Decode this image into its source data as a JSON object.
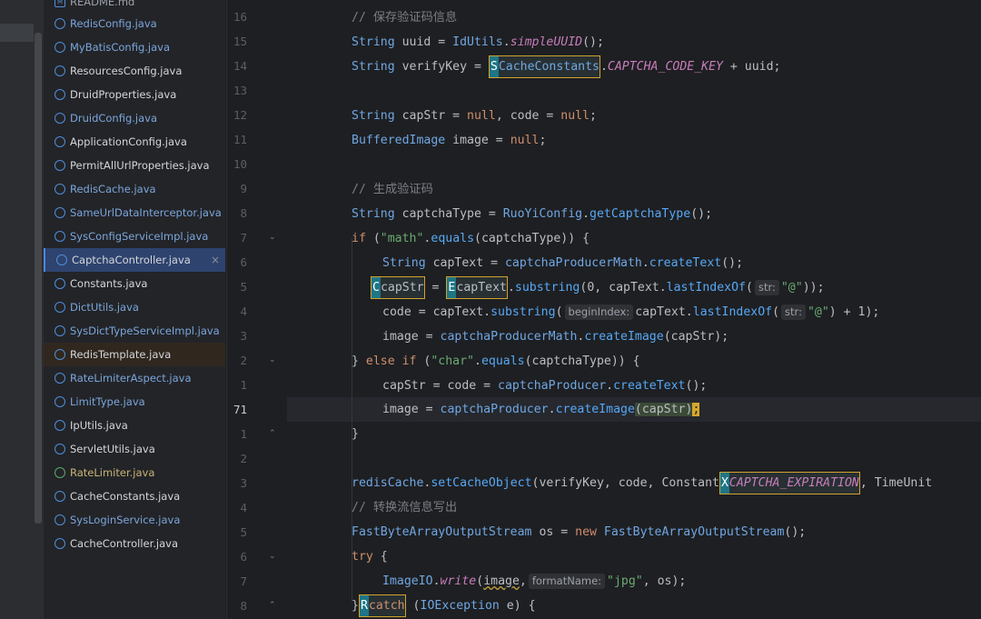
{
  "tree": {
    "top_partial": "README.md",
    "files": [
      {
        "name": "RedisConfig.java",
        "color": "blue"
      },
      {
        "name": "MyBatisConfig.java",
        "color": "blue"
      },
      {
        "name": "ResourcesConfig.java",
        "color": "normal"
      },
      {
        "name": "DruidProperties.java",
        "color": "normal"
      },
      {
        "name": "DruidConfig.java",
        "color": "blue"
      },
      {
        "name": "ApplicationConfig.java",
        "color": "normal"
      },
      {
        "name": "PermitAllUrlProperties.java",
        "color": "normal"
      },
      {
        "name": "RedisCache.java",
        "color": "blue"
      },
      {
        "name": "SameUrlDataInterceptor.java",
        "color": "blue"
      },
      {
        "name": "SysConfigServiceImpl.java",
        "color": "blue"
      },
      {
        "name": "CaptchaController.java",
        "color": "normal",
        "active": true
      },
      {
        "name": "Constants.java",
        "color": "normal"
      },
      {
        "name": "DictUtils.java",
        "color": "blue"
      },
      {
        "name": "SysDictTypeServiceImpl.java",
        "color": "blue"
      },
      {
        "name": "RedisTemplate.java",
        "color": "normal",
        "highlight": true
      },
      {
        "name": "RateLimiterAspect.java",
        "color": "blue"
      },
      {
        "name": "LimitType.java",
        "color": "blue"
      },
      {
        "name": "IpUtils.java",
        "color": "normal"
      },
      {
        "name": "ServletUtils.java",
        "color": "normal"
      },
      {
        "name": "RateLimiter.java",
        "color": "olive",
        "icon": "green"
      },
      {
        "name": "CacheConstants.java",
        "color": "normal"
      },
      {
        "name": "SysLoginService.java",
        "color": "blue"
      },
      {
        "name": "CacheController.java",
        "color": "normal"
      }
    ],
    "close_glyph": "×"
  },
  "gutter": {
    "line_numbers": [
      "16",
      "15",
      "14",
      "13",
      "12",
      "11",
      "10",
      "9",
      "8",
      "7",
      "6",
      "5",
      "4",
      "3",
      "2",
      "1",
      "71",
      "1",
      "2",
      "3",
      "4",
      "5",
      "6",
      "7",
      "8"
    ],
    "current_line": "71"
  },
  "hints": {
    "str": "str:",
    "beginIndex": "beginIndex:",
    "formatName": "formatName:"
  },
  "jump_labels": [
    "S",
    "C",
    "E",
    "X",
    "R"
  ],
  "code": {
    "l0": [
      "// 保存验证码信息"
    ],
    "l1": [
      "String",
      " uuid = ",
      "IdUtils",
      ".",
      "simpleUUID",
      "();"
    ],
    "l2": [
      "String",
      " verifyKey = ",
      "S",
      "CacheConstants",
      ".",
      "CAPTCHA_CODE_KEY",
      " + uuid;"
    ],
    "l4": [
      "String",
      " capStr = ",
      "null",
      ", code = ",
      "null",
      ";"
    ],
    "l5": [
      "BufferedImage",
      " image = ",
      "null",
      ";"
    ],
    "l7": [
      "// 生成验证码"
    ],
    "l8": [
      "String",
      " captchaType = ",
      "RuoYiConfig",
      ".",
      "getCaptchaType",
      "();"
    ],
    "l9": [
      "if",
      " (",
      "\"math\"",
      ".",
      "equals",
      "(captchaType)) {"
    ],
    "l10": [
      "String",
      " capText = ",
      "captchaProducerMath",
      ".",
      "createText",
      "();"
    ],
    "l11": [
      "C",
      "capStr",
      " = ",
      "E",
      "capText",
      ".",
      "substring",
      "(0, capText.",
      "lastIndexOf",
      "(",
      "\"@\"",
      "));"
    ],
    "l12": [
      "code = capText.",
      "substring",
      "(",
      "capText.",
      "lastIndexOf",
      "(",
      "\"@\"",
      ") + 1);"
    ],
    "l13": [
      "image = ",
      "captchaProducerMath",
      ".",
      "createImage",
      "(capStr);"
    ],
    "l14": [
      "} ",
      "else if",
      " (",
      "\"char\"",
      ".",
      "equals",
      "(captchaType)) {"
    ],
    "l15": [
      "capStr = code = ",
      "captchaProducer",
      ".",
      "createText",
      "();"
    ],
    "l16": [
      "image = ",
      "captchaProducer",
      ".",
      "createImage",
      "(capStr)",
      ";"
    ],
    "l17": [
      "}"
    ],
    "l19": [
      "redisCache",
      ".",
      "setCacheObject",
      "(verifyKey, code, ",
      "Constant",
      "X",
      "CAPTCHA_EXPIRATION",
      ", TimeUnit"
    ],
    "l20": [
      "// 转换流信息写出"
    ],
    "l21": [
      "FastByteArrayOutputStream",
      " os = ",
      "new",
      " ",
      "FastByteArrayOutputStream",
      "();"
    ],
    "l22": [
      "try",
      " {"
    ],
    "l23": [
      "ImageIO",
      ".",
      "write",
      "(",
      "image",
      ",",
      "\"jpg\"",
      ", os);"
    ],
    "l24": [
      "}",
      "R",
      "catch",
      " (",
      "IOException",
      " e) {"
    ]
  }
}
